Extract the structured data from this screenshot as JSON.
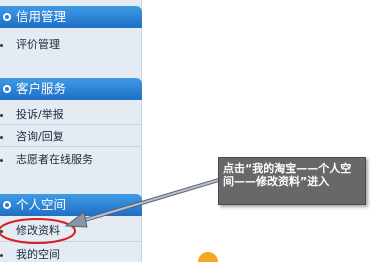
{
  "sidebar": {
    "sections": [
      {
        "title": "信用管理",
        "items": [
          "评价管理"
        ]
      },
      {
        "title": "客户服务",
        "items": [
          "投诉/举报",
          "咨询/回复",
          "志愿者在线服务"
        ]
      },
      {
        "title": "个人空间",
        "items": [
          "修改资料",
          "我的空间"
        ]
      }
    ]
  },
  "callout": {
    "text": "点击“我的淘宝——个人空间——修改资料”进入"
  },
  "colors": {
    "header": "#2a80d5",
    "sidebar_bg": "#e4ebf2",
    "callout_bg": "#686868",
    "highlight": "#d62020",
    "arrow": "#8a93a8"
  }
}
